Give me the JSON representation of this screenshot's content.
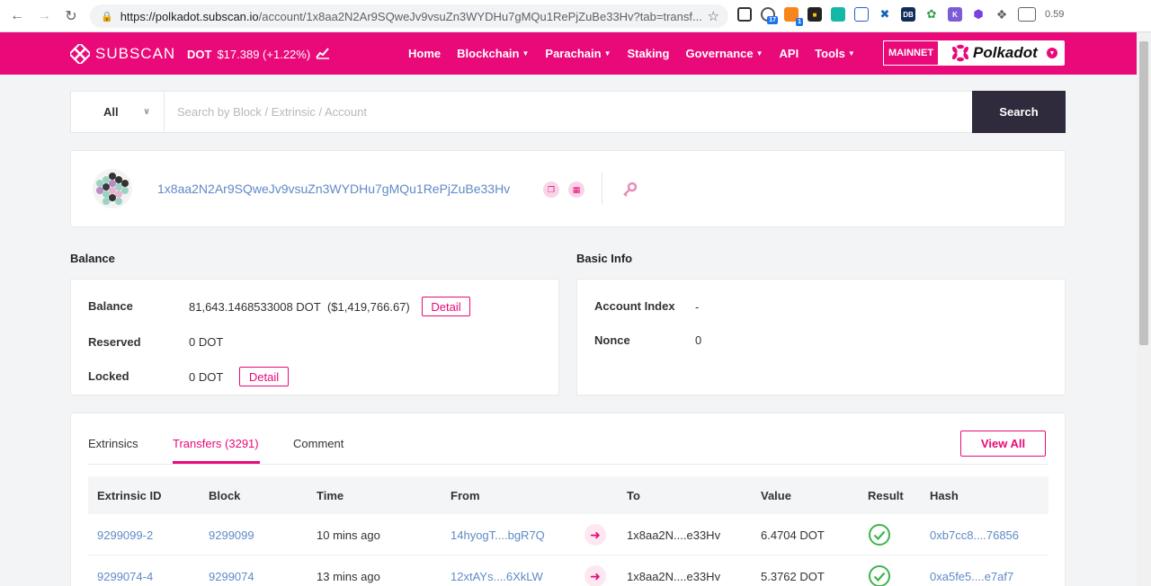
{
  "browser": {
    "url_host": "https://polkadot.subscan.io",
    "url_path": "/account/1x8aa2N2Ar9SQweJv9vsuZn3WYDHu7gMQu1RePjZuBe33Hv?tab=transf...",
    "ext_badge_1": "17",
    "ext_badge_2": "1",
    "ext_text": "0.59"
  },
  "nav": {
    "logo_text": "SUBSCAN",
    "price_symbol": "DOT",
    "price_value": "$17.389 (+1.22%)",
    "menu": [
      {
        "label": "Home"
      },
      {
        "label": "Blockchain"
      },
      {
        "label": "Parachain"
      },
      {
        "label": "Staking"
      },
      {
        "label": "Governance"
      },
      {
        "label": "API"
      },
      {
        "label": "Tools"
      }
    ],
    "network_label": "MAINNET",
    "chain_name": "Polkadot"
  },
  "search": {
    "filter_value": "All",
    "placeholder": "Search by Block / Extrinsic / Account",
    "button_label": "Search"
  },
  "account": {
    "address": "1x8aa2N2Ar9SQweJv9vsuZn3WYDHu7gMQu1RePjZuBe33Hv"
  },
  "balance": {
    "title": "Balance",
    "rows": [
      {
        "label": "Balance",
        "value": "81,643.1468533008 DOT",
        "usd": "($1,419,766.67)",
        "detail": "Detail"
      },
      {
        "label": "Reserved",
        "value": "0 DOT"
      },
      {
        "label": "Locked",
        "value": "0 DOT",
        "detail": "Detail"
      }
    ]
  },
  "basic_info": {
    "title": "Basic Info",
    "rows": [
      {
        "label": "Account Index",
        "value": "-"
      },
      {
        "label": "Nonce",
        "value": "0"
      }
    ]
  },
  "transfers": {
    "tabs": [
      {
        "label": "Extrinsics"
      },
      {
        "label": "Transfers (3291)"
      },
      {
        "label": "Comment"
      }
    ],
    "view_all": "View All",
    "columns": [
      "Extrinsic ID",
      "Block",
      "Time",
      "From",
      "To",
      "Value",
      "Result",
      "Hash"
    ],
    "rows": [
      {
        "extrinsic_id": "9299099-2",
        "block": "9299099",
        "time": "10 mins ago",
        "from": "14hyogT....bgR7Q",
        "to": "1x8aa2N....e33Hv",
        "value": "6.4704 DOT",
        "hash": "0xb7cc8....76856"
      },
      {
        "extrinsic_id": "9299074-4",
        "block": "9299074",
        "time": "13 mins ago",
        "from": "12xtAYs....6XkLW",
        "to": "1x8aa2N....e33Hv",
        "value": "5.3762 DOT",
        "hash": "0xa5fe5....e7af7"
      }
    ]
  },
  "colors": {
    "brand": "#e90979",
    "search_button": "#302b3c",
    "link": "#5f8ac7",
    "success": "#3bb54a"
  }
}
